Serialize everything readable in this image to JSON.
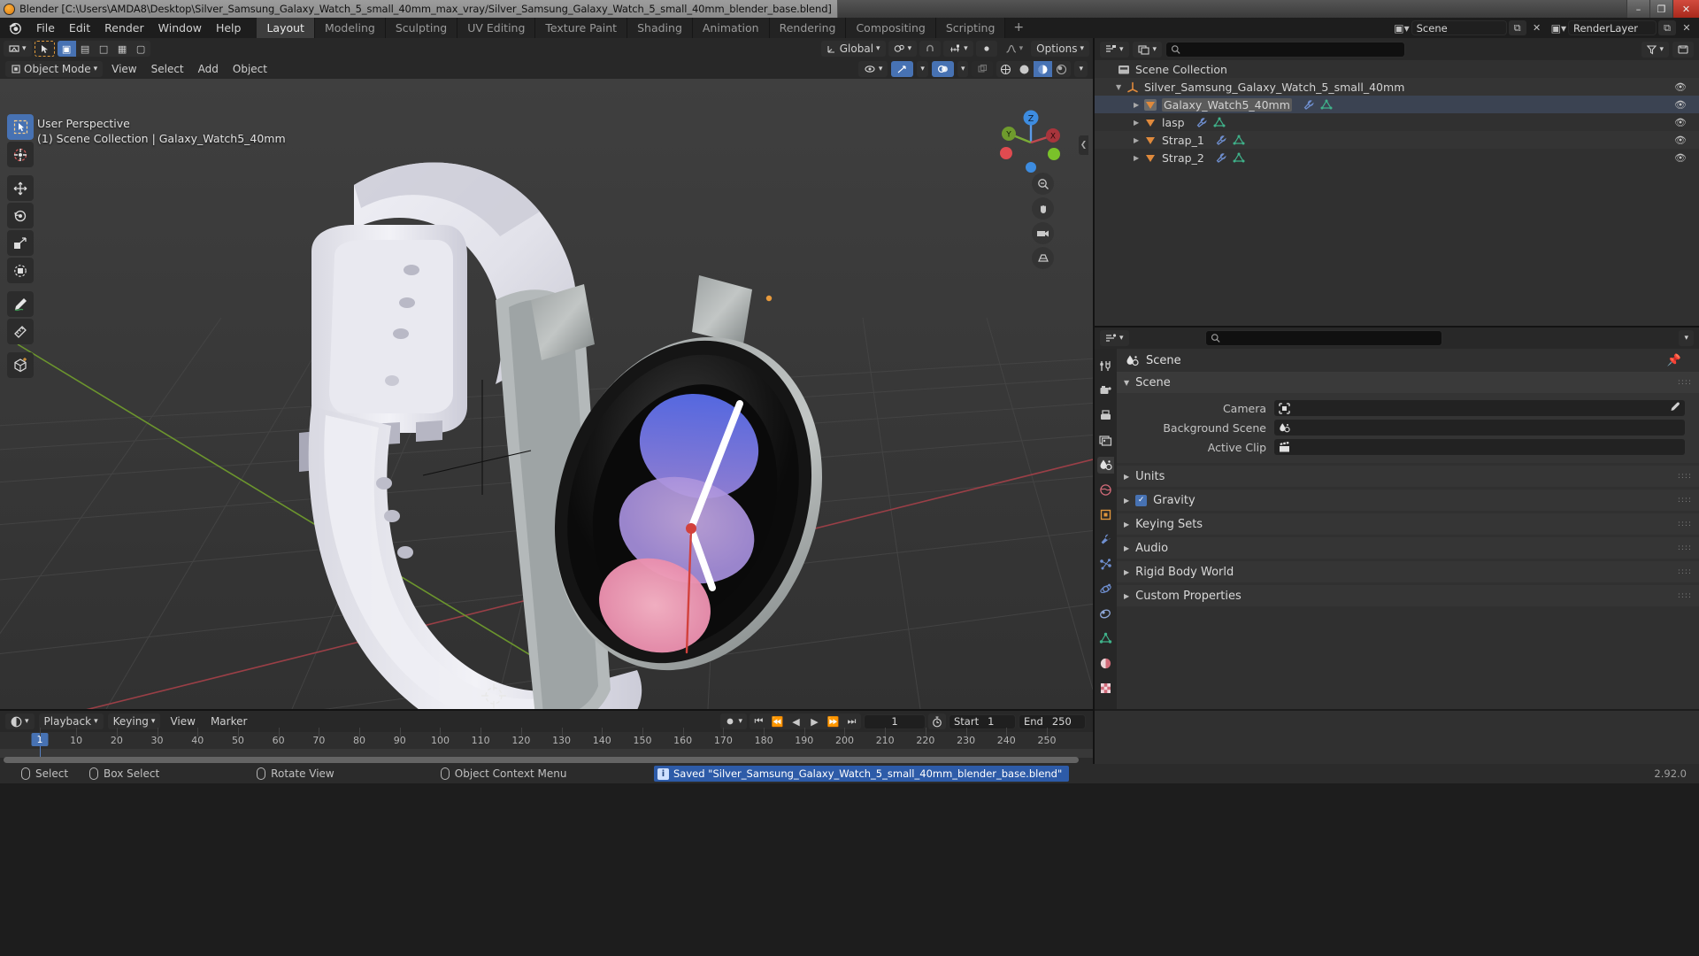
{
  "window": {
    "title": "Blender [C:\\Users\\AMDA8\\Desktop\\Silver_Samsung_Galaxy_Watch_5_small_40mm_max_vray/Silver_Samsung_Galaxy_Watch_5_small_40mm_blender_base.blend]",
    "minimize": "–",
    "maximize": "❐",
    "close": "✕"
  },
  "topbar": {
    "menus": [
      "File",
      "Edit",
      "Render",
      "Window",
      "Help"
    ],
    "workspaces": [
      {
        "label": "Layout",
        "active": true
      },
      {
        "label": "Modeling",
        "active": false
      },
      {
        "label": "Sculpting",
        "active": false
      },
      {
        "label": "UV Editing",
        "active": false
      },
      {
        "label": "Texture Paint",
        "active": false
      },
      {
        "label": "Shading",
        "active": false
      },
      {
        "label": "Animation",
        "active": false
      },
      {
        "label": "Rendering",
        "active": false
      },
      {
        "label": "Compositing",
        "active": false
      },
      {
        "label": "Scripting",
        "active": false
      }
    ],
    "add_workspace": "+",
    "scene_name": "Scene",
    "view_layer_name": "RenderLayer",
    "new_scene": "⧉",
    "unlink_scene": "✕",
    "new_layer": "⧉",
    "unlink_layer": "✕"
  },
  "viewport": {
    "mode": "Object Mode",
    "menus": [
      "View",
      "Select",
      "Add",
      "Object"
    ],
    "transform_orientation": "Global",
    "options_label": "Options",
    "overlay_text_line1": "User Perspective",
    "overlay_text_line2": "(1) Scene Collection | Galaxy_Watch5_40mm",
    "gizmo_axes": [
      "Z",
      "Y",
      "X"
    ],
    "tools": [
      "tweak-select-tool",
      "cursor-tool",
      "move-tool",
      "rotate-tool",
      "scale-tool",
      "transform-tool",
      "annotate-tool",
      "measure-tool",
      "add-cube-tool"
    ],
    "shading_modes": [
      "wireframe",
      "solid",
      "material-preview",
      "rendered"
    ],
    "active_shading_mode": "material-preview"
  },
  "outliner": {
    "display_mode": "View Layer",
    "search_placeholder": "",
    "filter_icon": "funnel-icon",
    "rows": [
      {
        "label": "Scene Collection",
        "indent": 0,
        "icon": "collection-icon",
        "expandable": false,
        "eye": false,
        "selected": false
      },
      {
        "label": "Silver_Samsung_Galaxy_Watch_5_small_40mm",
        "indent": 1,
        "icon": "empty-axes-icon",
        "expandable": true,
        "expanded": true,
        "eye": true,
        "selected": false
      },
      {
        "label": "Galaxy_Watch5_40mm",
        "indent": 2,
        "icon": "mesh-icon",
        "expandable": true,
        "expanded": false,
        "eye": true,
        "selected": true,
        "subicons": [
          "modifier-icon",
          "mesh-data-icon"
        ]
      },
      {
        "label": "lasp",
        "indent": 2,
        "icon": "mesh-icon",
        "expandable": true,
        "expanded": false,
        "eye": true,
        "selected": false,
        "subicons": [
          "modifier-icon",
          "mesh-data-icon"
        ]
      },
      {
        "label": "Strap_1",
        "indent": 2,
        "icon": "mesh-icon",
        "expandable": true,
        "expanded": false,
        "eye": true,
        "selected": false,
        "subicons": [
          "modifier-icon",
          "mesh-data-icon"
        ]
      },
      {
        "label": "Strap_2",
        "indent": 2,
        "icon": "mesh-icon",
        "expandable": true,
        "expanded": false,
        "eye": true,
        "selected": false,
        "subicons": [
          "modifier-icon",
          "mesh-data-icon"
        ]
      }
    ]
  },
  "properties": {
    "breadcrumb": "Scene",
    "search_placeholder": "",
    "tabs": [
      "tool-icon",
      "render-icon",
      "output-icon",
      "view-layer-icon",
      "scene-icon",
      "world-icon",
      "object-icon",
      "modifier-icon",
      "particles-icon",
      "physics-icon",
      "constraints-icon",
      "data-icon",
      "material-icon",
      "texture-icon"
    ],
    "active_tab": "scene-icon",
    "panels": [
      {
        "label": "Scene",
        "open": true,
        "fields": [
          {
            "label": "Camera",
            "value": "",
            "icon": "camera-icon",
            "eyedropper": true
          },
          {
            "label": "Background Scene",
            "value": "",
            "icon": "scene-icon",
            "eyedropper": false
          },
          {
            "label": "Active Clip",
            "value": "",
            "icon": "clip-icon",
            "eyedropper": false
          }
        ]
      },
      {
        "label": "Units",
        "open": false,
        "checkbox": null
      },
      {
        "label": "Gravity",
        "open": false,
        "checkbox": true
      },
      {
        "label": "Keying Sets",
        "open": false,
        "checkbox": null
      },
      {
        "label": "Audio",
        "open": false,
        "checkbox": null
      },
      {
        "label": "Rigid Body World",
        "open": false,
        "checkbox": null
      },
      {
        "label": "Custom Properties",
        "open": false,
        "checkbox": null
      }
    ]
  },
  "timeline": {
    "menus": [
      "Playback",
      "Keying",
      "View",
      "Marker"
    ],
    "current_frame": "1",
    "start_label": "Start",
    "start_value": "1",
    "end_label": "End",
    "end_value": "250",
    "playhead_frame": "1",
    "ticks": [
      "1",
      "10",
      "20",
      "30",
      "40",
      "50",
      "60",
      "70",
      "80",
      "90",
      "100",
      "110",
      "120",
      "130",
      "140",
      "150",
      "160",
      "170",
      "180",
      "190",
      "200",
      "210",
      "220",
      "230",
      "240",
      "250"
    ],
    "transport": [
      "jump-start-icon",
      "prev-keyframe-icon",
      "play-reverse-icon",
      "play-icon",
      "next-keyframe-icon",
      "jump-end-icon"
    ]
  },
  "statusbar": {
    "items": [
      {
        "icon": "mouse-left-icon",
        "label": "Select"
      },
      {
        "icon": "mouse-left-drag-icon",
        "label": "Box Select"
      },
      {
        "icon": "mouse-middle-icon",
        "label": "Rotate View"
      },
      {
        "icon": "mouse-right-icon",
        "label": "Object Context Menu"
      }
    ],
    "report": "Saved \"Silver_Samsung_Galaxy_Watch_5_small_40mm_blender_base.blend\"",
    "version": "2.92.0"
  },
  "colors": {
    "accent_blue": "#4772b3",
    "header_bg": "#282828",
    "editor_bg": "#303030",
    "viewport_bg": "#393939",
    "axis_x_red": "#c2484e",
    "axis_y_green": "#7aab36",
    "watch_face_blue": "#6e7fe0",
    "watch_face_pink": "#f0a0b8"
  }
}
